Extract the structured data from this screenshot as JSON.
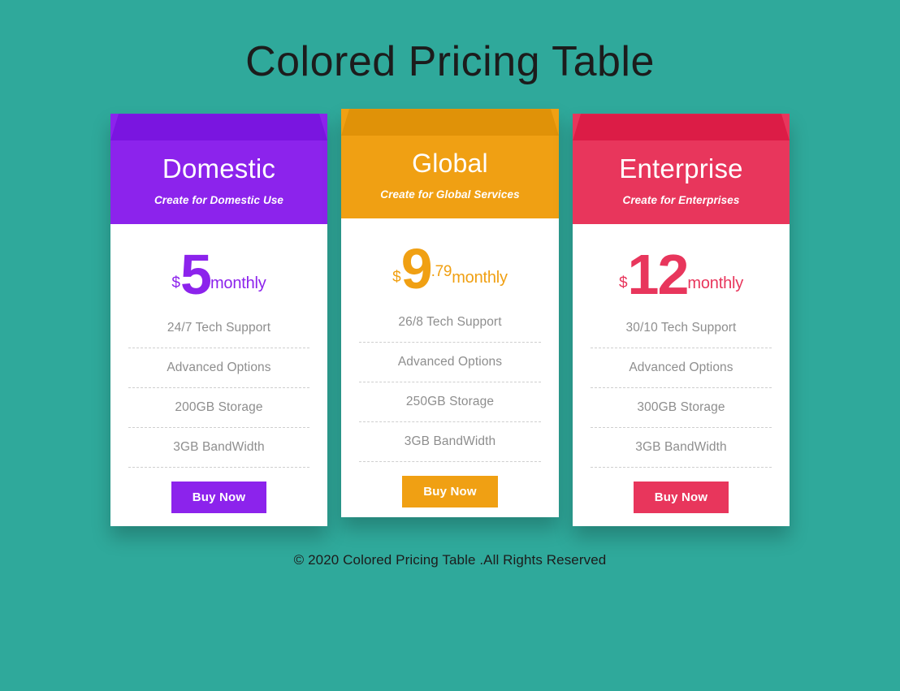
{
  "page": {
    "title": "Colored Pricing Table",
    "background_color": "#2fa99b",
    "footer": "© 2020 Colored Pricing Table .All Rights Reserved"
  },
  "plans": [
    {
      "name": "Domestic",
      "tagline": "Create for Domestic Use",
      "currency": "$",
      "amount": "5",
      "cents": "",
      "period": "monthly",
      "features": [
        "24/7 Tech Support",
        "Advanced Options",
        "200GB Storage",
        "3GB BandWidth"
      ],
      "cta": "Buy Now",
      "color": "#8c23ec",
      "color_dark": "#7a15e0"
    },
    {
      "name": "Global",
      "tagline": "Create for Global Services",
      "currency": "$",
      "amount": "9",
      "cents": ".79",
      "period": "monthly",
      "features": [
        "26/8 Tech Support",
        "Advanced Options",
        "250GB Storage",
        "3GB BandWidth"
      ],
      "cta": "Buy Now",
      "color": "#f0a013",
      "color_dark": "#e09208"
    },
    {
      "name": "Enterprise",
      "tagline": "Create for Enterprises",
      "currency": "$",
      "amount": "12",
      "cents": "",
      "period": "monthly",
      "features": [
        "30/10 Tech Support",
        "Advanced Options",
        "300GB Storage",
        "3GB BandWidth"
      ],
      "cta": "Buy Now",
      "color": "#e8365c",
      "color_dark": "#dc1c46"
    }
  ]
}
